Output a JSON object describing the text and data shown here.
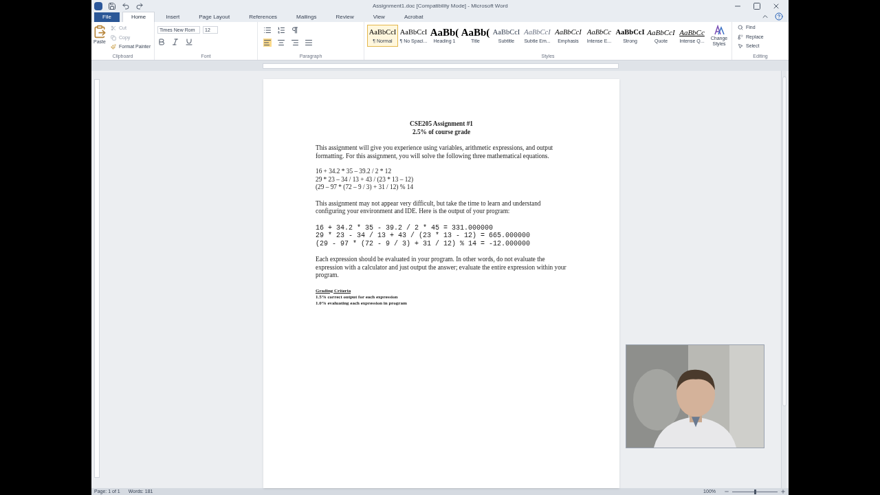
{
  "window": {
    "title": "Assignment1.doc [Compatibility Mode]  -  Microsoft Word"
  },
  "tabs": [
    {
      "label": "File",
      "selected": false,
      "kind": "file"
    },
    {
      "label": "Home",
      "selected": true,
      "kind": "tab"
    },
    {
      "label": "Insert",
      "selected": false,
      "kind": "tab"
    },
    {
      "label": "Page Layout",
      "selected": false,
      "kind": "tab"
    },
    {
      "label": "References",
      "selected": false,
      "kind": "tab"
    },
    {
      "label": "Mailings",
      "selected": false,
      "kind": "tab"
    },
    {
      "label": "Review",
      "selected": false,
      "kind": "tab"
    },
    {
      "label": "View",
      "selected": false,
      "kind": "tab"
    },
    {
      "label": "Acrobat",
      "selected": false,
      "kind": "tab"
    }
  ],
  "clipboard": {
    "paste": "Paste",
    "cut": "Cut",
    "copy": "Copy",
    "format_painter": "Format Painter",
    "label": "Clipboard"
  },
  "font": {
    "name": "Times New Rom",
    "size": "12",
    "label": "Font"
  },
  "paragraph": {
    "label": "Paragraph"
  },
  "styles": {
    "label": "Styles",
    "items": [
      {
        "preview": "AaBbCcI",
        "name": "¶ Normal",
        "selected": true
      },
      {
        "preview": "AaBbCcI",
        "name": "¶ No Spaci...",
        "selected": false
      },
      {
        "preview": "AaBb(",
        "name": "Heading 1",
        "selected": false
      },
      {
        "preview": "AaBb(",
        "name": "Title",
        "selected": false
      },
      {
        "preview": "AaBbCcI",
        "name": "Subtitle",
        "selected": false
      },
      {
        "preview": "AaBbCcI",
        "name": "Subtle Em...",
        "selected": false
      },
      {
        "preview": "AaBbCcI",
        "name": "Emphasis",
        "selected": false
      },
      {
        "preview": "AaBbCc",
        "name": "Intense E...",
        "selected": false
      },
      {
        "preview": "AaBbCcI",
        "name": "Strong",
        "selected": false
      },
      {
        "preview": "AaBbCcI",
        "name": "Quote",
        "selected": false
      },
      {
        "preview": "AaBbCc",
        "name": "Intense Q...",
        "selected": false
      }
    ],
    "change_styles": "Change Styles"
  },
  "editing": {
    "find": "Find",
    "replace": "Replace",
    "select": "Select",
    "label": "Editing"
  },
  "document": {
    "title": "CSE205 Assignment #1",
    "subtitle": "2.5% of course grade",
    "intro": "This assignment will give you experience using variables, arithmetic expressions, and output formatting.  For this assignment, you will solve the following three mathematical equations.",
    "equations": [
      "16 + 34.2 * 35 – 39.2 / 2 * 12",
      "29 * 23 – 34 / 13 + 43 / (23 * 13 – 12)",
      "(29 – 97 * (72 – 9 / 3) + 31 / 12) % 14"
    ],
    "note": "This assignment may not appear very difficult, but take the time to learn and understand configuring your environment and IDE.  Here is the output of your program:",
    "output": [
      "16 + 34.2 * 35 - 39.2 / 2 * 45 = 331.000000",
      "29 * 23 - 34 / 13 + 43 / (23 * 13 - 12) = 665.000000",
      "(29 - 97 * (72 - 9 / 3) + 31 / 12) % 14 = -12.000000"
    ],
    "instructions": "Each expression should be evaluated in your program.  In other words, do not evaluate the expression with a calculator and just output the answer; evaluate the entire expression within your program.",
    "grading_heading": "Grading Criteria",
    "criteria": [
      "1.5% correct output  for each expression",
      "1.0% evaluating each expression in program"
    ]
  },
  "status_bar": {
    "page": "Page: 1 of 1",
    "words": "Words: 181",
    "zoom": "100%",
    "zoom_level": {
      "level": 0.5
    }
  }
}
